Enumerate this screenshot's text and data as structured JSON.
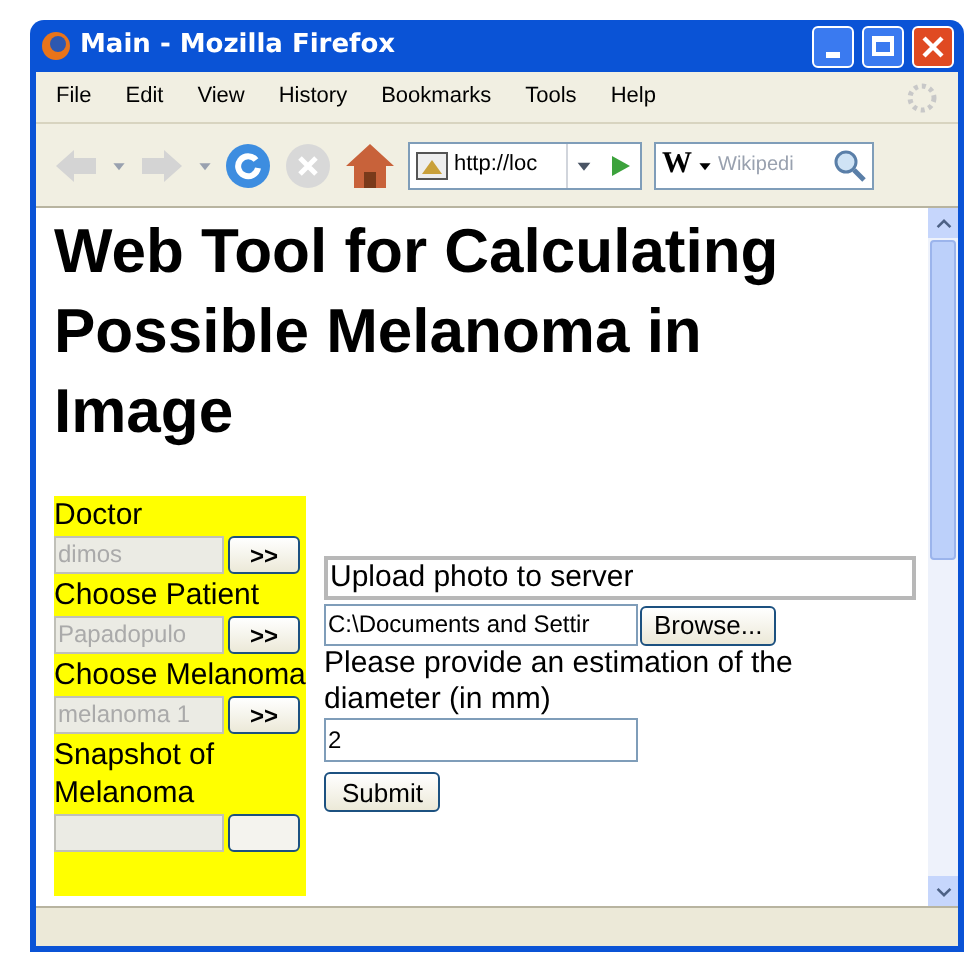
{
  "window": {
    "title": "Main - Mozilla Firefox"
  },
  "menu": [
    "File",
    "Edit",
    "View",
    "History",
    "Bookmarks",
    "Tools",
    "Help"
  ],
  "toolbar": {
    "address": "http://loc",
    "search_engine": "W",
    "search_placeholder": "Wikipedi"
  },
  "page": {
    "heading": "Web Tool for Calculating Possible Melanoma in Image",
    "sidebar": [
      {
        "label": "Doctor",
        "value": "dimos",
        "button": ">>"
      },
      {
        "label": "Choose Patient",
        "value": "Papadopulo",
        "button": ">>"
      },
      {
        "label": "Choose Melanoma",
        "value": "melanoma 1",
        "button": ">>"
      },
      {
        "label": "Snapshot of Melanoma"
      }
    ],
    "upload_title": "Upload photo to server",
    "file_path": "C:\\Documents and Settir",
    "browse_button": "Browse...",
    "prompt": "Please provide an estimation of the diameter (in mm)",
    "diameter": "2",
    "submit_button": "Submit"
  }
}
